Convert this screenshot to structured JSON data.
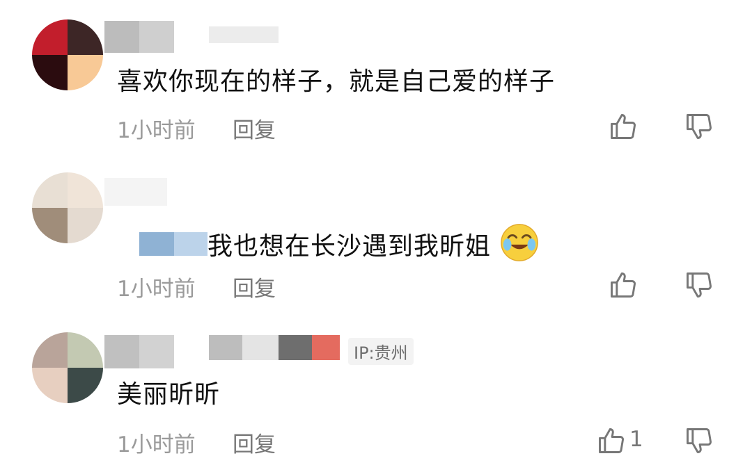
{
  "comments": [
    {
      "text": "喜欢你现在的样子，就是自己爱的样子",
      "time": "1小时前",
      "reply_label": "回复"
    },
    {
      "text": "我也想在长沙遇到我昕姐",
      "emoji": "crying-laughing-emoji",
      "time": "1小时前",
      "reply_label": "回复"
    },
    {
      "text": "美丽昕昕",
      "ip_label": "IP:贵州",
      "time": "1小时前",
      "reply_label": "回复",
      "like_count": "1"
    }
  ],
  "icons": {
    "like": "thumbs-up-icon",
    "dislike": "thumbs-down-icon"
  },
  "colors": {
    "meta_text": "#9a9a9a",
    "icon": "#777777"
  }
}
